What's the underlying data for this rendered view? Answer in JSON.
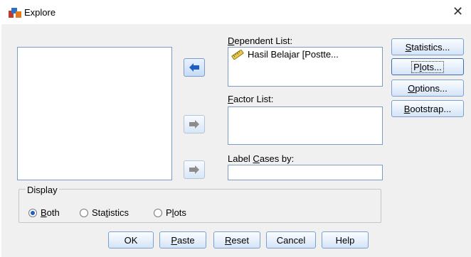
{
  "window": {
    "title": "Explore",
    "close_glyph": "✕",
    "icon": "spss-explore-icon"
  },
  "dependent_list": {
    "label_pre": "",
    "label_u": "D",
    "label_post": "ependent List:",
    "items": [
      {
        "text": "Hasil Belajar [Postte...",
        "icon": "scale-ruler-icon"
      }
    ]
  },
  "factor_list": {
    "label_pre": "",
    "label_u": "F",
    "label_post": "actor List:"
  },
  "label_cases": {
    "label_pre": "Label ",
    "label_u": "C",
    "label_post": "ases by:"
  },
  "side_buttons": [
    {
      "pre": "",
      "u": "S",
      "post": "tatistics..."
    },
    {
      "pre": "P",
      "u": "l",
      "post": "ots..."
    },
    {
      "pre": "",
      "u": "O",
      "post": "ptions..."
    },
    {
      "pre": "",
      "u": "B",
      "post": "ootstrap..."
    }
  ],
  "display": {
    "legend": "Display",
    "options": [
      {
        "pre": "",
        "u": "B",
        "post": "oth",
        "selected": true
      },
      {
        "pre": "Sta",
        "u": "t",
        "post": "istics",
        "selected": false
      },
      {
        "pre": "P",
        "u": "l",
        "post": "ots",
        "selected": false
      }
    ]
  },
  "bottom_buttons": [
    {
      "pre": "OK",
      "u": "",
      "post": ""
    },
    {
      "pre": "",
      "u": "P",
      "post": "aste"
    },
    {
      "pre": "",
      "u": "R",
      "post": "eset"
    },
    {
      "pre": "Cancel",
      "u": "",
      "post": ""
    },
    {
      "pre": "Help",
      "u": "",
      "post": ""
    }
  ],
  "colors": {
    "arrow_active": "#1f5fbf",
    "arrow_disabled": "#8c8c8c",
    "accent_border": "#7a9cc6"
  }
}
